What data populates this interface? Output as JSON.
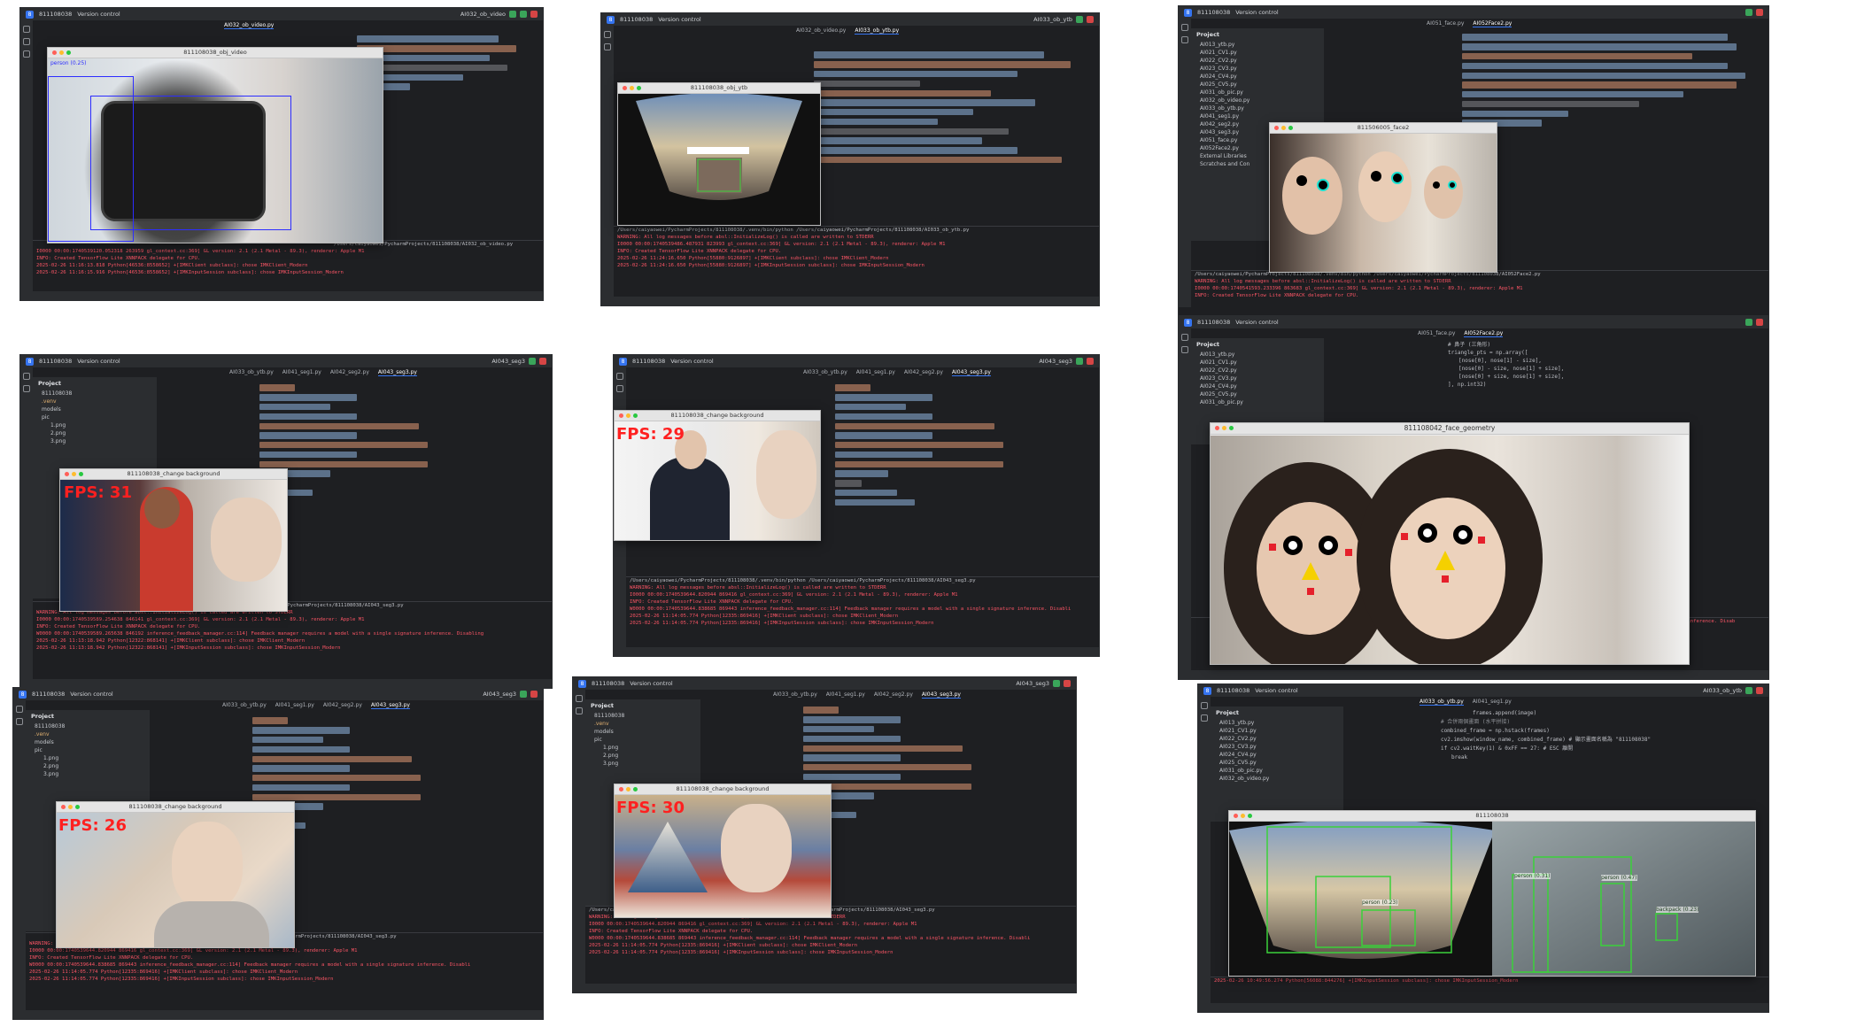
{
  "colors": {
    "ide_bg": "#1e1f22",
    "ide_panel": "#2b2d30",
    "accent": "#3574f0",
    "error_text": "#f75464",
    "fps_red": "#ff2020",
    "detection_blue": "#2d2dff",
    "detection_green": "#3ad13a"
  },
  "tiles": [
    {
      "project_badge": "811108038",
      "vcs": "Version control",
      "run_config": "AI032_ob_video",
      "tabs": [
        "AI032_ob_video.py"
      ],
      "window_title": "811108038_obj_video",
      "detection_label": "person (0.25)",
      "run_path": "/Users/caiyaowei/PycharmProjects/811108038/AI032_ob_video.py",
      "console": [
        "I0000 00:00:1740539120.052318  263959 gl_context.cc:369] GL version: 2.1 (2.1 Metal - 89.3), renderer: Apple M1",
        "INFO: Created TensorFlow Lite XNNPACK delegate for CPU.",
        "2025-02-26 11:16:13.818 Python[46536:8558652] +[IMKClient subclass]: chose IMKClient_Modern",
        "2025-02-26 11:16:15.916 Python[46536:8558652] +[IMKInputSession subclass]: chose IMKInputSession_Modern"
      ]
    },
    {
      "project_badge": "811108038",
      "vcs": "Version control",
      "run_config": "AI033_ob_ytb",
      "tabs": [
        "AI032_ob_video.py",
        "AI033_ob_ytb.py"
      ],
      "window_title": "811108038_obj_ytb",
      "run_path": "/Users/caiyaowei/PycharmProjects/811108038/.venv/bin/python /Users/caiyaowei/PycharmProjects/811108038/AI033_ob_ytb.py",
      "console": [
        "WARNING: All log messages before absl::InitializeLog() is called are written to STDERR",
        "I0000 00:00:1740539486.487931  823993 gl_context.cc:369] GL version: 2.1 (2.1 Metal - 89.3), renderer: Apple M1",
        "INFO: Created TensorFlow Lite XNNPACK delegate for CPU.",
        "2025-02-26 11:24:16.650 Python[55880:9126897] +[IMKClient subclass]: chose IMKClient_Modern",
        "2025-02-26 11:24:16.650 Python[55880:9126897] +[IMKInputSession subclass]: chose IMKInputSession_Modern"
      ]
    },
    {
      "project_badge": "811108038",
      "vcs": "Version control",
      "tabs": [
        "AI051_face.py",
        "AI052Face2.py"
      ],
      "window_title": "811506005_face2",
      "files": [
        "AI013_ytb.py",
        "AI021_CV1.py",
        "AI022_CV2.py",
        "AI023_CV3.py",
        "AI024_CV4.py",
        "AI025_CV5.py",
        "AI031_ob_pic.py",
        "AI032_ob_video.py",
        "AI033_ob_ytb.py",
        "AI041_seg1.py",
        "AI042_seg2.py",
        "AI043_seg3.py",
        "AI051_face.py",
        "AI052Face2.py",
        "External Libraries",
        "Scratches and Con"
      ],
      "run_path": "/Users/caiyaowei/PycharmProjects/811108038/.venv/bin/python /Users/caiyaowei/PycharmProjects/811108038/AI052Face2.py",
      "console": [
        "WARNING: All log messages before absl::InitializeLog() is called are written to STDERR",
        "I0000 00:00:1740541593.233396  863683 gl_context.cc:369] GL version: 2.1 (2.1 Metal - 89.3), renderer: Apple M1",
        "INFO: Created TensorFlow Lite XNNPACK delegate for CPU."
      ]
    },
    {
      "project_badge": "811108038",
      "vcs": "Version control",
      "run_config": "AI043_seg3",
      "tabs": [
        "AI033_ob_ytb.py",
        "AI041_seg1.py",
        "AI042_seg2.py",
        "AI043_seg3.py"
      ],
      "window_title": "811108038_change background",
      "fps": "FPS: 31",
      "files": [
        "811108038",
        ".venv",
        "models",
        "pic",
        "1.png",
        "2.png",
        "3.png"
      ],
      "run_path": "/Users/caiyaowei/PycharmProjects/811108038/AI043_seg3.py",
      "console": [
        "WARNING: All log messages before absl::InitializeLog() is called are written to STDERR",
        "I0000 00:00:1740539589.254638  846141 gl_context.cc:369] GL version: 2.1 (2.1 Metal - 89.3), renderer: Apple M1",
        "INFO: Created TensorFlow Lite XNNPACK delegate for CPU.",
        "W0000 00:00:1740539589.265638  846192 inference_feedback_manager.cc:114] Feedback manager requires a model with a single signature inference. Disabling",
        "2025-02-26 11:13:18.942 Python[12322:868141] +[IMKClient subclass]: chose IMKClient_Modern",
        "2025-02-26 11:13:18.942 Python[12322:868141] +[IMKInputSession subclass]: chose IMKInputSession_Modern"
      ]
    },
    {
      "project_badge": "811108038",
      "vcs": "Version control",
      "run_config": "AI043_seg3",
      "tabs": [
        "AI033_ob_ytb.py",
        "AI041_seg1.py",
        "AI042_seg2.py",
        "AI043_seg3.py"
      ],
      "window_title": "811108038_change background",
      "fps": "FPS: 29",
      "run_path": "/Users/caiyaowei/PycharmProjects/811108038/.venv/bin/python /Users/caiyaowei/PycharmProjects/811108038/AI043_seg3.py",
      "console": [
        "WARNING: All log messages before absl::InitializeLog() is called are written to STDERR",
        "I0000 00:00:1740539644.820944  869416 gl_context.cc:369] GL version: 2.1 (2.1 Metal - 89.3), renderer: Apple M1",
        "INFO: Created TensorFlow Lite XNNPACK delegate for CPU.",
        "W0000 00:00:1740539644.838685  869443 inference_feedback_manager.cc:114] Feedback manager requires a model with a single signature inference. Disabli",
        "2025-02-26 11:14:05.774 Python[12335:869416] +[IMKClient subclass]: chose IMKClient_Modern",
        "2025-02-26 11:14:05.774 Python[12335:869416] +[IMKInputSession subclass]: chose IMKInputSession_Modern"
      ]
    },
    {
      "project_badge": "811108038",
      "vcs": "Version control",
      "tabs": [
        "AI051_face.py",
        "AI052Face2.py"
      ],
      "window_title": "811108042_face_geometry",
      "files": [
        "AI013_ytb.py",
        "AI021_CV1.py",
        "AI022_CV2.py",
        "AI023_CV3.py",
        "AI024_CV4.py",
        "AI025_CV5.py",
        "AI031_ob_pic.py"
      ],
      "code_snippet": [
        "# 鼻子 (三角形)",
        "triangle_pts = np.array([",
        "[nose[0], nose[1] - size],",
        "[nose[0] - size, nose[1] + size],",
        "[nose[0] + size, nose[1] + size],",
        "], np.int32)"
      ],
      "console": [
        "n signature inference. Disab"
      ]
    },
    {
      "project_badge": "811108038",
      "vcs": "Version control",
      "run_config": "AI043_seg3",
      "tabs": [
        "AI033_ob_ytb.py",
        "AI041_seg1.py",
        "AI042_seg2.py",
        "AI043_seg3.py"
      ],
      "window_title": "811108038_change background",
      "fps": "FPS: 26",
      "files": [
        "811108038",
        ".venv",
        "models",
        "pic",
        "1.png",
        "2.png",
        "3.png"
      ],
      "run_path": "/Users/caiyaowei/PycharmProjects/811108038/AI043_seg3.py",
      "console": [
        "WARNING: All log messages before absl::InitializeLog() is called are written to STDERR",
        "I0000 00:00:1740539644.820944  869416 gl_context.cc:369] GL version: 2.1 (2.1 Metal - 89.3), renderer: Apple M1",
        "INFO: Created TensorFlow Lite XNNPACK delegate for CPU.",
        "W0000 00:00:1740539644.838685  869443 inference_feedback_manager.cc:114] Feedback manager requires a model with a single signature inference. Disabli",
        "2025-02-26 11:14:05.774 Python[12335:869416] +[IMKClient subclass]: chose IMKClient_Modern",
        "2025-02-26 11:14:05.774 Python[12335:869416] +[IMKInputSession subclass]: chose IMKInputSession_Modern"
      ]
    },
    {
      "project_badge": "811108038",
      "vcs": "Version control",
      "run_config": "AI043_seg3",
      "tabs": [
        "AI033_ob_ytb.py",
        "AI041_seg1.py",
        "AI042_seg2.py",
        "AI043_seg3.py"
      ],
      "window_title": "811108038_change background",
      "fps": "FPS: 30",
      "files": [
        "811108038",
        ".venv",
        "models",
        "pic",
        "1.png",
        "2.png",
        "3.png"
      ],
      "run_path": "/Users/caiyaowei/PycharmProjects/811108038/.venv/bin/python /Users/caiyaowei/PycharmProjects/811108038/AI043_seg3.py",
      "console": [
        "WARNING: All log messages before absl::InitializeLog() is called are written to STDERR",
        "I0000 00:00:1740539644.820944  869416 gl_context.cc:369] GL version: 2.1 (2.1 Metal - 89.3), renderer: Apple M1",
        "INFO: Created TensorFlow Lite XNNPACK delegate for CPU.",
        "W0000 00:00:1740539644.838685  869443 inference_feedback_manager.cc:114] Feedback manager requires a model with a single signature inference. Disabli",
        "2025-02-26 11:14:05.774 Python[12335:869416] +[IMKClient subclass]: chose IMKClient_Modern",
        "2025-02-26 11:14:05.774 Python[12335:869416] +[IMKInputSession subclass]: chose IMKInputSession_Modern"
      ]
    },
    {
      "project_badge": "811108038",
      "vcs": "Version control",
      "run_config": "AI033_ob_ytb",
      "tabs": [
        "AI033_ob_ytb.py",
        "AI041_seg1.py"
      ],
      "window_title": "811108038",
      "files": [
        "AI013_ytb.py",
        "AI021_CV1.py",
        "AI022_CV2.py",
        "AI023_CV3.py",
        "AI024_CV4.py",
        "AI025_CV5.py",
        "AI031_ob_pic.py",
        "AI032_ob_video.py"
      ],
      "code_snippet": [
        "frames.append(image)",
        "# 合併兩個畫面 (水平拼接)",
        "combined_frame = np.hstack(frames)",
        "cv2.imshow(window_name, combined_frame)  # 顯示畫面名稱為 \"811108038\"",
        "if cv2.waitKey(1) & 0xFF == 27:  # ESC 離開",
        "break"
      ],
      "labels": [
        "person (0.23)",
        "person (0.31)",
        "person (0.47)",
        "backpack (0.23)"
      ],
      "console": [
        "2025-02-26 10:49:56.274 Python[56088:844276] +[IMKInputSession subclass]: chose IMKInputSession_Modern"
      ]
    }
  ]
}
